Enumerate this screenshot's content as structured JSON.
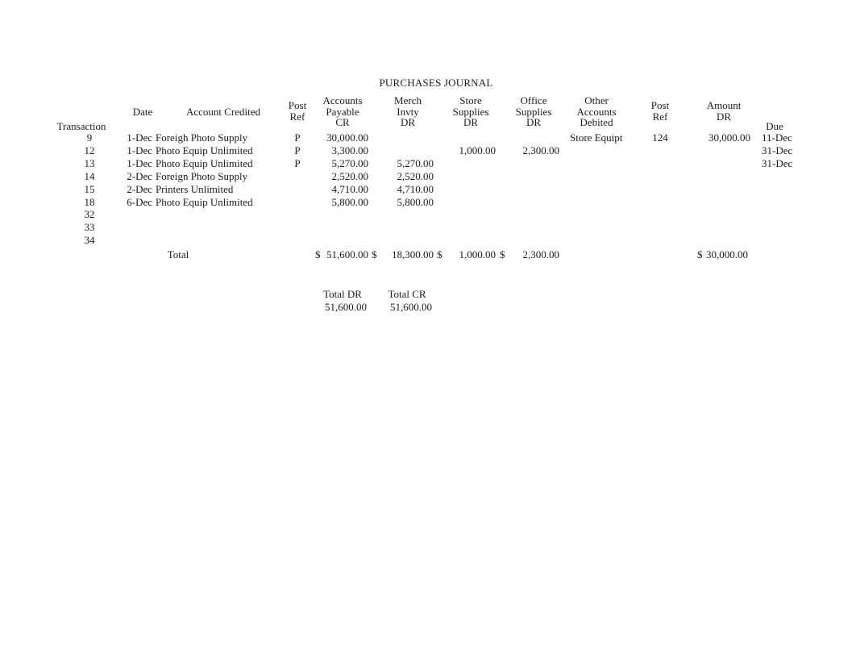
{
  "document": {
    "title": "PURCHASES JOURNAL"
  },
  "columns": {
    "transaction": "Transaction",
    "date": "Date",
    "account_credited": "Account Credited",
    "post_ref_1": [
      "Post",
      "Ref"
    ],
    "accounts_payable": [
      "Accounts",
      "Payable",
      "CR"
    ],
    "merch_invty": [
      "Merch",
      "Invty",
      "DR"
    ],
    "store_supplies": [
      "Store",
      "Supplies",
      "DR"
    ],
    "office_supplies": [
      "Office",
      "Supplies",
      "DR"
    ],
    "other_accounts": [
      "Other",
      "Accounts",
      "Debited"
    ],
    "post_ref_2": [
      "Post",
      "Ref"
    ],
    "amount": [
      "Amount",
      "DR"
    ],
    "due": "Due"
  },
  "rows": [
    {
      "transaction": "9",
      "date": "1-Dec",
      "account_credited": "Foreigh Photo Supply",
      "post_ref_1": "P",
      "accounts_payable": "30,000.00",
      "merch_invty": "",
      "store_supplies": "",
      "office_supplies": "",
      "other_accounts": "Store Equipt",
      "post_ref_2": "124",
      "amount": "30,000.00",
      "due": "11-Dec"
    },
    {
      "transaction": "12",
      "date": "1-Dec",
      "account_credited": "Photo Equip Unlimited",
      "post_ref_1": "P",
      "accounts_payable": "3,300.00",
      "merch_invty": "",
      "store_supplies": "1,000.00",
      "office_supplies": "2,300.00",
      "other_accounts": "",
      "post_ref_2": "",
      "amount": "",
      "due": "31-Dec"
    },
    {
      "transaction": "13",
      "date": "1-Dec",
      "account_credited": "Photo Equip Unlimited",
      "post_ref_1": "P",
      "accounts_payable": "5,270.00",
      "merch_invty": "5,270.00",
      "store_supplies": "",
      "office_supplies": "",
      "other_accounts": "",
      "post_ref_2": "",
      "amount": "",
      "due": "31-Dec"
    },
    {
      "transaction": "14",
      "date": "2-Dec",
      "account_credited": "Foreign Photo Supply",
      "post_ref_1": "",
      "accounts_payable": "2,520.00",
      "merch_invty": "2,520.00",
      "store_supplies": "",
      "office_supplies": "",
      "other_accounts": "",
      "post_ref_2": "",
      "amount": "",
      "due": ""
    },
    {
      "transaction": "15",
      "date": "2-Dec",
      "account_credited": "Printers Unlimited",
      "post_ref_1": "",
      "accounts_payable": "4,710.00",
      "merch_invty": "4,710.00",
      "store_supplies": "",
      "office_supplies": "",
      "other_accounts": "",
      "post_ref_2": "",
      "amount": "",
      "due": ""
    },
    {
      "transaction": "18",
      "date": "6-Dec",
      "account_credited": "Photo Equip Unlimited",
      "post_ref_1": "",
      "accounts_payable": "5,800.00",
      "merch_invty": "5,800.00",
      "store_supplies": "",
      "office_supplies": "",
      "other_accounts": "",
      "post_ref_2": "",
      "amount": "",
      "due": ""
    },
    {
      "transaction": "32",
      "date": "",
      "account_credited": "",
      "post_ref_1": "",
      "accounts_payable": "",
      "merch_invty": "",
      "store_supplies": "",
      "office_supplies": "",
      "other_accounts": "",
      "post_ref_2": "",
      "amount": "",
      "due": ""
    },
    {
      "transaction": "33",
      "date": "",
      "account_credited": "",
      "post_ref_1": "",
      "accounts_payable": "",
      "merch_invty": "",
      "store_supplies": "",
      "office_supplies": "",
      "other_accounts": "",
      "post_ref_2": "",
      "amount": "",
      "due": ""
    },
    {
      "transaction": "34",
      "date": "",
      "account_credited": "",
      "post_ref_1": "",
      "accounts_payable": "",
      "merch_invty": "",
      "store_supplies": "",
      "office_supplies": "",
      "other_accounts": "",
      "post_ref_2": "",
      "amount": "",
      "due": ""
    }
  ],
  "total_row": {
    "label": "Total",
    "currency_symbol": "$",
    "accounts_payable": "51,600.00",
    "merch_invty": "18,300.00",
    "store_supplies": "1,000.00",
    "office_supplies": "2,300.00",
    "amount": "30,000.00"
  },
  "footer_totals": {
    "total_dr_label": "Total DR",
    "total_cr_label": "Total CR",
    "total_dr_value": "51,600.00",
    "total_cr_value": "51,600.00"
  }
}
